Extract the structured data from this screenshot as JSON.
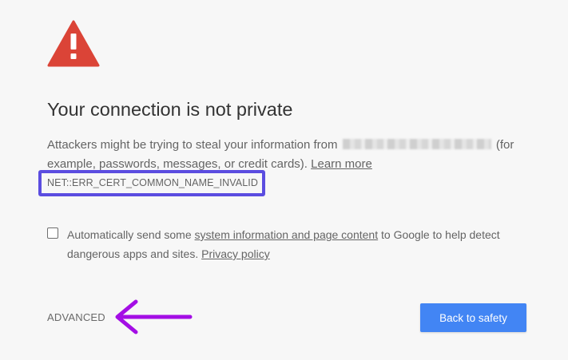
{
  "interstitial": {
    "title": "Your connection is not private",
    "explanation_part1": "Attackers might be trying to steal your information from",
    "explanation_part2": "(for example, passwords, messages, or credit cards).",
    "learn_more": "Learn more",
    "error_code": "NET::ERR_CERT_COMMON_NAME_INVALID",
    "optin_part1": "Automatically send some",
    "optin_link": "system information and page content",
    "optin_part2": "to Google to help detect dangerous apps and sites.",
    "privacy_policy": "Privacy policy",
    "advanced": "ADVANCED",
    "back_to_safety": "Back to safety"
  },
  "colors": {
    "warning_red": "#db4437",
    "highlight_border": "#5b4de0",
    "annotation_arrow": "#a40ee5",
    "primary_button": "#4285f4",
    "background": "#f7f7f7"
  },
  "icons": {
    "warning": "warning-triangle-icon",
    "arrow": "left-arrow-annotation-icon"
  }
}
